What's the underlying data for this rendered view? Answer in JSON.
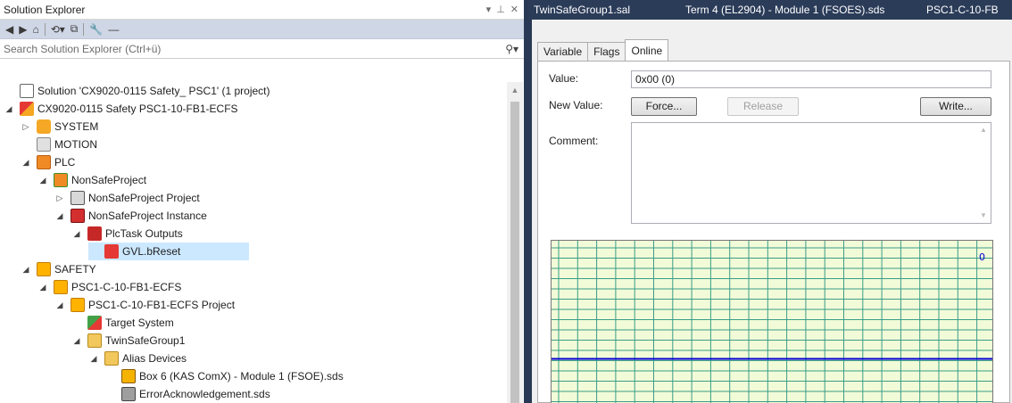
{
  "solution_explorer": {
    "title": "Solution Explorer",
    "pin_glyph": "▾ ⊥ ✕",
    "search_placeholder": "Search Solution Explorer (Ctrl+ü)",
    "tree": [
      {
        "label": "Solution 'CX9020-0115 Safety_ PSC1' (1 project)",
        "icon": "solution-icon",
        "level": 0,
        "expander": ""
      },
      {
        "label": "CX9020-0115 Safety PSC1-10-FB1-ECFS",
        "icon": "project-icon",
        "level": 0,
        "expander": "◢"
      },
      {
        "label": "SYSTEM",
        "icon": "system-icon",
        "level": 1,
        "expander": "▷"
      },
      {
        "label": "MOTION",
        "icon": "motion-icon",
        "level": 1,
        "expander": ""
      },
      {
        "label": "PLC",
        "icon": "plc-icon",
        "level": 1,
        "expander": "◢"
      },
      {
        "label": "NonSafeProject",
        "icon": "plc-project-icon",
        "level": 2,
        "expander": "◢"
      },
      {
        "label": "NonSafeProject Project",
        "icon": "plc-project-file-icon",
        "level": 3,
        "expander": "▷"
      },
      {
        "label": "NonSafeProject Instance",
        "icon": "plc-instance-icon",
        "level": 3,
        "expander": "◢"
      },
      {
        "label": "PlcTask Outputs",
        "icon": "task-outputs-icon",
        "level": 4,
        "expander": "◢"
      },
      {
        "label": "GVL.bReset",
        "icon": "output-variable-icon",
        "level": 5,
        "expander": "",
        "selected": true
      },
      {
        "label": "SAFETY",
        "icon": "safety-icon",
        "level": 1,
        "expander": "◢"
      },
      {
        "label": "PSC1-C-10-FB1-ECFS",
        "icon": "safety-project-icon",
        "level": 2,
        "expander": "◢"
      },
      {
        "label": "PSC1-C-10-FB1-ECFS Project",
        "icon": "safety-project-file-icon",
        "level": 3,
        "expander": "◢"
      },
      {
        "label": "Target System",
        "icon": "target-system-icon",
        "level": 4,
        "expander": ""
      },
      {
        "label": "TwinSafeGroup1",
        "icon": "folder-open-icon",
        "level": 4,
        "expander": "◢"
      },
      {
        "label": "Alias Devices",
        "icon": "folder-open-icon",
        "level": 5,
        "expander": "◢"
      },
      {
        "label": "Box 6 (KAS ComX) - Module 1 (FSOE).sds",
        "icon": "alias-device-icon",
        "level": 6,
        "expander": ""
      },
      {
        "label": "ErrorAcknowledgement.sds",
        "icon": "alias-file-icon",
        "level": 6,
        "expander": ""
      }
    ]
  },
  "document_tabs": [
    "TwinSafeGroup1.sal",
    "Term 4 (EL2904) - Module 1 (FSOES).sds",
    "PSC1-C-10-FB"
  ],
  "editor": {
    "tabs": [
      "Variable",
      "Flags",
      "Online"
    ],
    "active_tab": "Online",
    "value_label": "Value:",
    "value": "0x00 (0)",
    "new_value_label": "New Value:",
    "force_button": "Force...",
    "release_button": "Release",
    "write_button": "Write...",
    "comment_label": "Comment:",
    "comment_text": "",
    "trend_current_value": "0"
  },
  "chart_data": {
    "type": "line",
    "title": "",
    "xlabel": "",
    "ylabel": "",
    "series": [
      {
        "values": [
          0,
          0,
          0,
          0,
          0,
          0,
          0,
          0,
          0,
          0
        ]
      }
    ],
    "current_value": 0,
    "grid": true,
    "line_color": "#0000d0",
    "background": "#f2fbd8"
  },
  "colors": {
    "chrome_dark": "#293955",
    "selection": "#cce8ff",
    "trend_line": "#0000d0",
    "grid_line": "#3a9d88"
  }
}
